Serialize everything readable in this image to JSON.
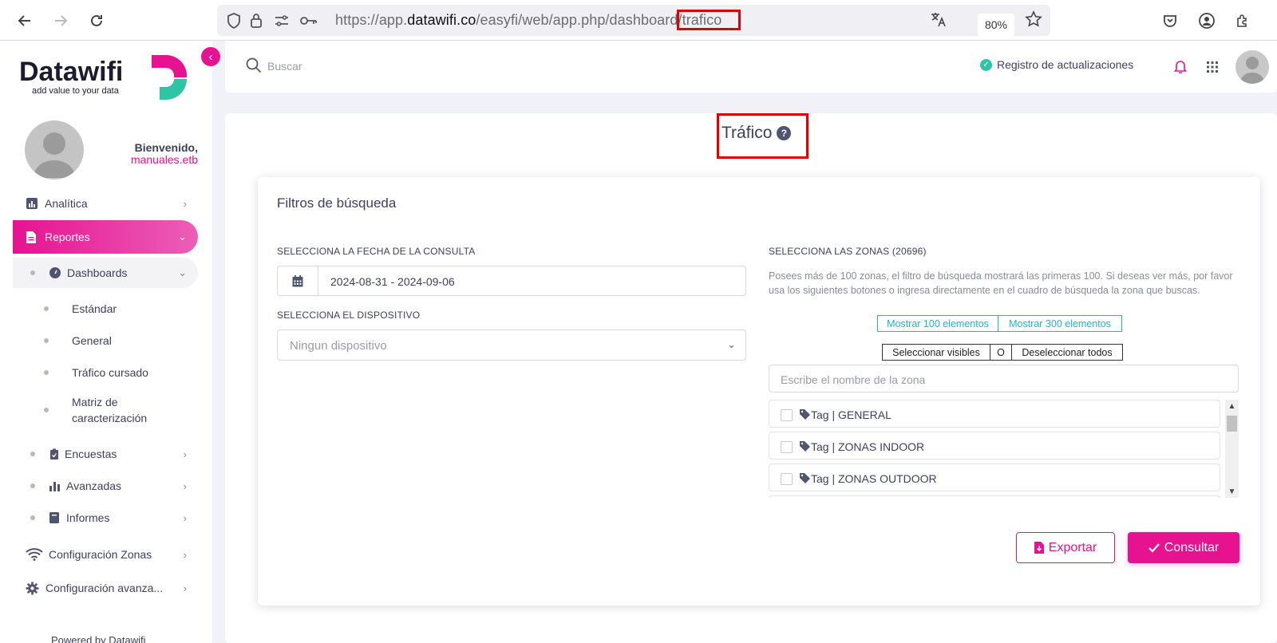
{
  "browser": {
    "url_prefix": "https://app.",
    "url_domain": "datawifi.co",
    "url_path": "/easyfi/web/app.php/dashboard/",
    "url_highlighted": "trafico",
    "zoom": "80%"
  },
  "sidebar": {
    "logo_name": "Datawifi",
    "logo_tagline": "add value to your data",
    "welcome": "Bienvenido,",
    "username": "manuales.etb",
    "items": [
      {
        "label": "Analítica"
      },
      {
        "label": "Reportes"
      },
      {
        "label": "Dashboards"
      },
      {
        "label": "Estándar"
      },
      {
        "label": "General"
      },
      {
        "label": "Tráfico cursado"
      },
      {
        "label": "Matriz de caracterización"
      },
      {
        "label": "Encuestas"
      },
      {
        "label": "Avanzadas"
      },
      {
        "label": "Informes"
      },
      {
        "label": "Configuración Zonas"
      },
      {
        "label": "Configuración avanza..."
      }
    ],
    "powered": "Powered by Datawifi"
  },
  "header": {
    "search_placeholder": "Buscar",
    "update_log": "Registro de actualizaciones"
  },
  "page": {
    "title": "Tráfico"
  },
  "filters": {
    "title": "Filtros de búsqueda",
    "date_label": "SELECCIONA LA FECHA DE LA CONSULTA",
    "date_value": "2024-08-31 - 2024-09-06",
    "device_label": "SELECCIONA EL DISPOSITIVO",
    "device_value": "Ningun dispositivo",
    "zones_label": "SELECCIONA LAS ZONAS (20696)",
    "zones_note": "Posees más de 100 zonas, el filtro de búsqueda mostrará las primeras 100. Si deseas ver más, por favor usa los siguientes botones o ingresa directamente en el cuadro de búsqueda la zona que buscas.",
    "show_100": "Mostrar 100 elementos",
    "show_300": "Mostrar 300 elementos",
    "select_visible": "Seleccionar visibles",
    "or": "O",
    "deselect_all": "Deseleccionar todos",
    "zone_search_placeholder": "Escribe el nombre de la zona",
    "zones": [
      {
        "label": "Tag | GENERAL"
      },
      {
        "label": "Tag | ZONAS INDOOR"
      },
      {
        "label": "Tag | ZONAS OUTDOOR"
      }
    ],
    "export_label": "Exportar",
    "consult_label": "Consultar"
  },
  "colors": {
    "brand": "#e6128f",
    "accent_teal": "#2ec4a6",
    "highlight_box": "#e10000"
  }
}
